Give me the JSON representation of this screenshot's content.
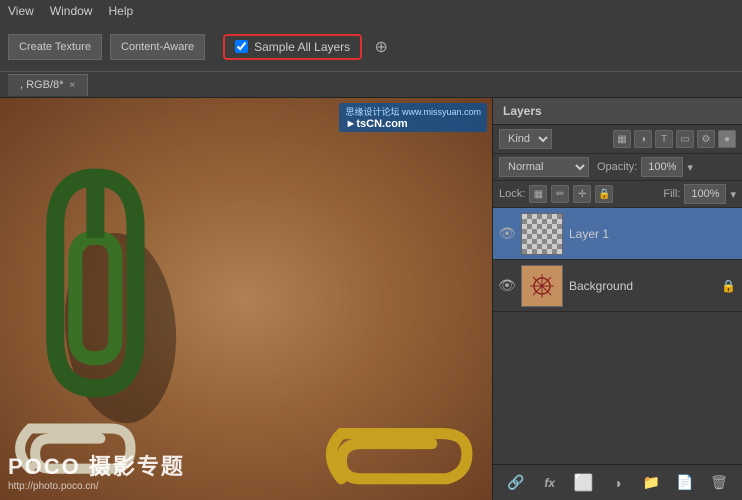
{
  "menubar": {
    "items": [
      "View",
      "Window",
      "Help"
    ]
  },
  "toolbar": {
    "btn1_label": "Create Texture",
    "btn2_label": "Content-Aware",
    "sample_all_layers_label": "Sample All Layers",
    "sample_checked": true
  },
  "tab": {
    "label": ", RGB/8*",
    "close_label": "×"
  },
  "layers_panel": {
    "title": "Layers",
    "kind_label": "Kind",
    "blend_mode": "Normal",
    "opacity_label": "Opacity:",
    "opacity_value": "100%",
    "lock_label": "Lock:",
    "fill_label": "Fill:",
    "fill_value": "100%",
    "layers": [
      {
        "name": "Layer 1",
        "visible": true,
        "selected": true,
        "type": "transparent"
      },
      {
        "name": "Background",
        "visible": true,
        "selected": false,
        "type": "background",
        "locked": true
      }
    ],
    "bottom_buttons": [
      "link",
      "fx",
      "mask",
      "adjustment",
      "group",
      "new",
      "delete"
    ]
  },
  "watermark": {
    "logo": "POCO 摄影专题",
    "url": "http://photo.poco.cn/"
  },
  "tscn": {
    "text": "思缘设计论坛 www.missyuan.com\n►tsCN.com"
  },
  "icons": {
    "eye": "👁",
    "link": "🔗",
    "fx": "fx",
    "mask": "⊙",
    "adjustment": "◑",
    "group": "📁",
    "new": "📄",
    "delete": "🗑",
    "lock": "🔒",
    "target": "⊕",
    "pixels": "▦",
    "brush": "✏",
    "position": "✛",
    "lock_icon": "🔒"
  }
}
